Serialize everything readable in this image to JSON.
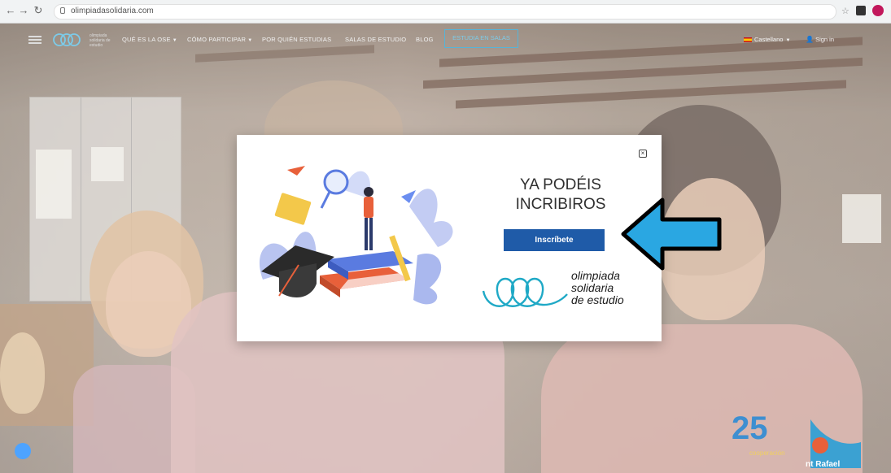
{
  "browser": {
    "url": "olimpiadasolidaria.com"
  },
  "navbar": {
    "logo_caption": "olimpiada solidaria de estudio",
    "items": [
      {
        "label": "QUÉ ES LA OSE",
        "dropdown": true
      },
      {
        "label": "CÓMO PARTICIPAR",
        "dropdown": true
      },
      {
        "label": "POR QUIÉN ESTUDIAS",
        "dropdown": false
      },
      {
        "label": "SALAS DE ESTUDIO",
        "dropdown": false
      },
      {
        "label": "BLOG",
        "dropdown": false
      }
    ],
    "cta_label": "ESTUDIA EN SALAS",
    "language": "Castellano",
    "signin": "Sign in"
  },
  "modal": {
    "title_line1": "YA PODÉIS",
    "title_line2": "INCRIBIROS",
    "button_label": "Inscríbete",
    "brand_line1": "olimpiada",
    "brand_line2": "solidaria",
    "brand_line3": "de estudio",
    "icons": [
      "close-icon",
      "arrow-left-icon"
    ]
  },
  "footer_logos": {
    "anniversary": "25",
    "anniversary_sub": "cooperación",
    "school": "nt Rafael"
  },
  "colors": {
    "cta_blue": "#1f5ba8",
    "brand_teal": "#1fa9c6",
    "arrow_blue": "#2aa7e2",
    "nav_outline": "#56b4d8"
  }
}
